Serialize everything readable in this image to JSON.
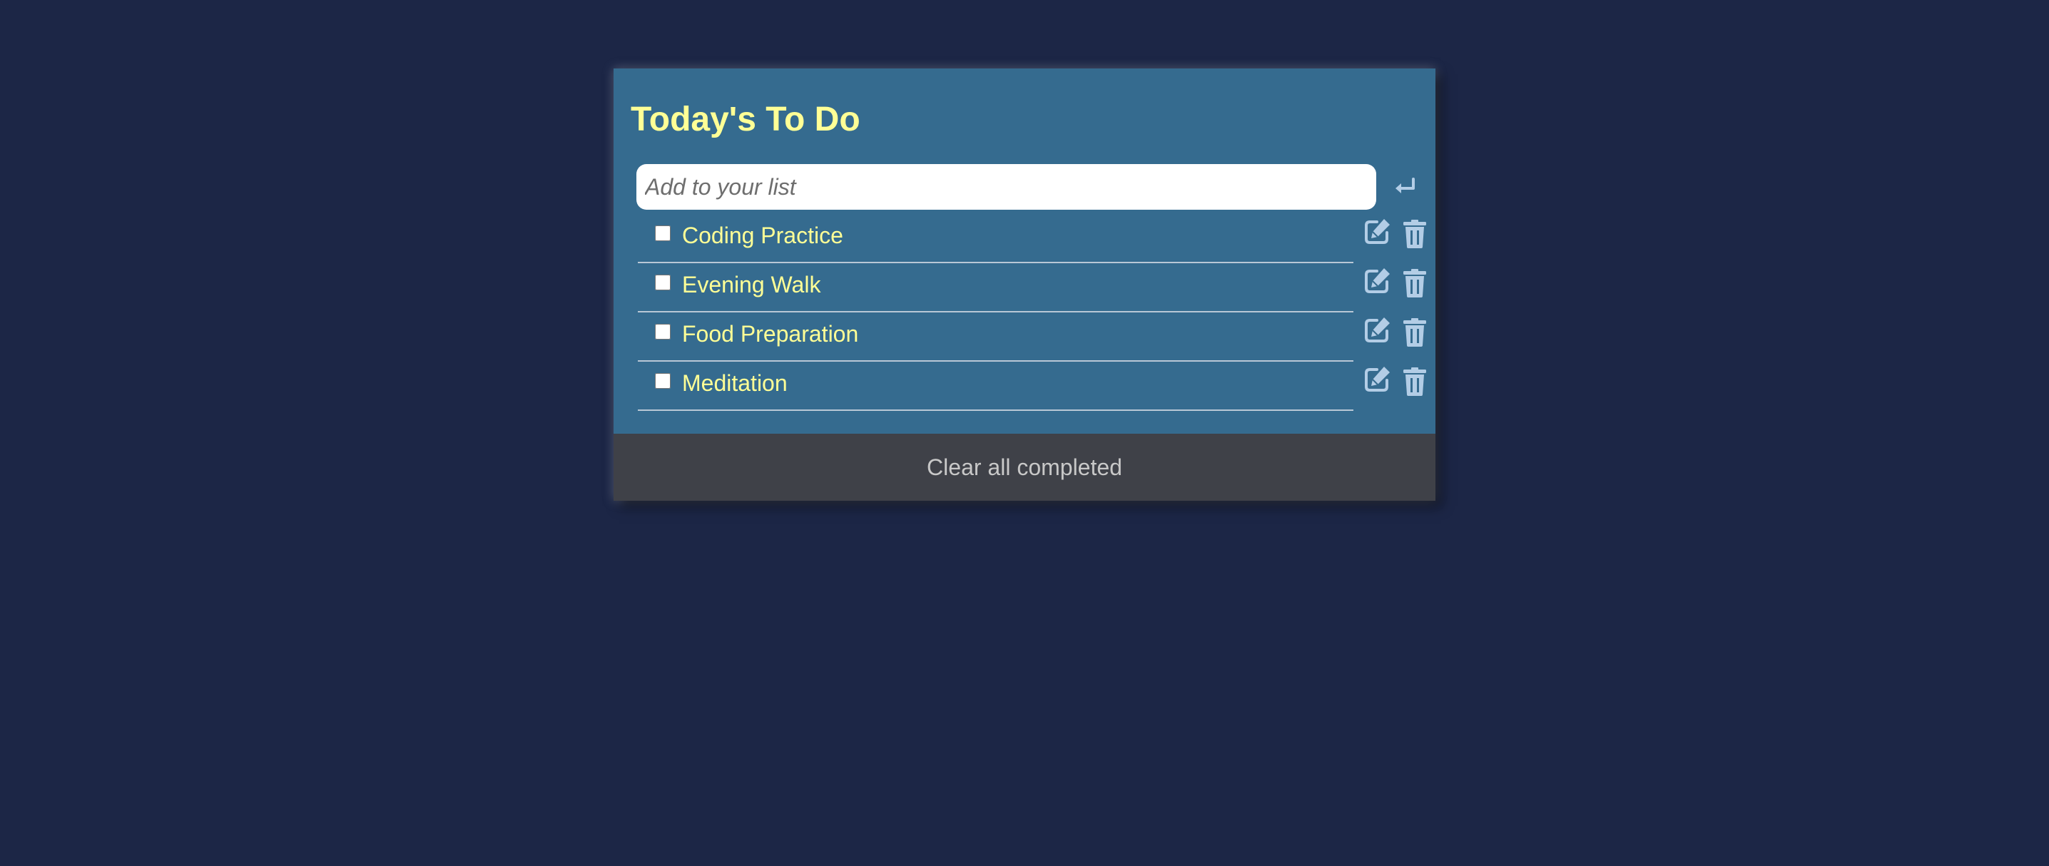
{
  "header": {
    "title": "Today's To Do"
  },
  "add_input": {
    "placeholder": "Add to your list",
    "value": "",
    "submit_icon": "enter-icon"
  },
  "todos": [
    {
      "label": "Coding Practice",
      "completed": false
    },
    {
      "label": "Evening Walk",
      "completed": false
    },
    {
      "label": "Food Preparation",
      "completed": false
    },
    {
      "label": "Meditation",
      "completed": false
    }
  ],
  "item_icons": {
    "edit": "edit-icon",
    "delete": "trash-icon"
  },
  "footer": {
    "clear_label": "Clear all completed"
  },
  "colors": {
    "page_background": "#1c2646",
    "card_background": "#356b8f",
    "footer_background": "#3f4148",
    "title_text": "#ffff96",
    "item_text": "#ffff96",
    "icon": "#b3cde6",
    "footer_text": "#c8c8c8"
  }
}
